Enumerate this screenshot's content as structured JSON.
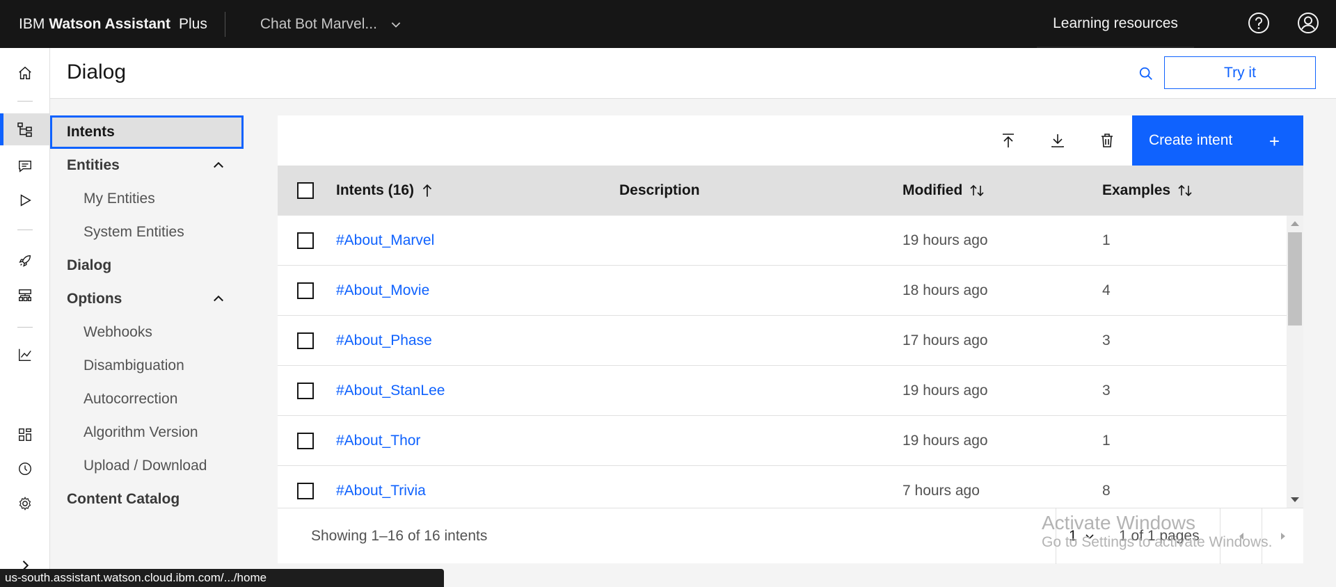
{
  "topbar": {
    "brand_prefix": "IBM",
    "brand_name": "Watson Assistant",
    "plan": "Plus",
    "assistant_name": "Chat Bot Marvel...",
    "learning_resources": "Learning resources"
  },
  "page": {
    "title": "Dialog",
    "try_it": "Try it"
  },
  "subnav": {
    "intents": "Intents",
    "entities": "Entities",
    "my_entities": "My Entities",
    "system_entities": "System Entities",
    "dialog": "Dialog",
    "options": "Options",
    "webhooks": "Webhooks",
    "disambiguation": "Disambiguation",
    "autocorrection": "Autocorrection",
    "algorithm_version": "Algorithm Version",
    "upload_download": "Upload / Download",
    "content_catalog": "Content Catalog"
  },
  "toolbar": {
    "create_intent": "Create intent",
    "icons": [
      "upload-icon",
      "download-icon",
      "trash-icon"
    ]
  },
  "table": {
    "headers": {
      "intents": "Intents (16)",
      "description": "Description",
      "modified": "Modified",
      "examples": "Examples"
    },
    "rows": [
      {
        "name": "#About_Marvel",
        "description": "",
        "modified": "19 hours ago",
        "examples": "1"
      },
      {
        "name": "#About_Movie",
        "description": "",
        "modified": "18 hours ago",
        "examples": "4"
      },
      {
        "name": "#About_Phase",
        "description": "",
        "modified": "17 hours ago",
        "examples": "3"
      },
      {
        "name": "#About_StanLee",
        "description": "",
        "modified": "19 hours ago",
        "examples": "3"
      },
      {
        "name": "#About_Thor",
        "description": "",
        "modified": "19 hours ago",
        "examples": "1"
      },
      {
        "name": "#About_Trivia",
        "description": "",
        "modified": "7 hours ago",
        "examples": "8"
      }
    ]
  },
  "pagination": {
    "status": "Showing 1–16 of 16 intents",
    "current_page": "1",
    "page_of": "1 of 1 pages"
  },
  "watermark": {
    "line1": "Activate Windows",
    "line2": "Go to Settings to activate Windows."
  },
  "statusbar": {
    "url": "us-south.assistant.watson.cloud.ibm.com/.../home"
  },
  "colors": {
    "accent": "#0f62fe",
    "topbar": "#161616",
    "header_row": "#e0e0e0"
  }
}
